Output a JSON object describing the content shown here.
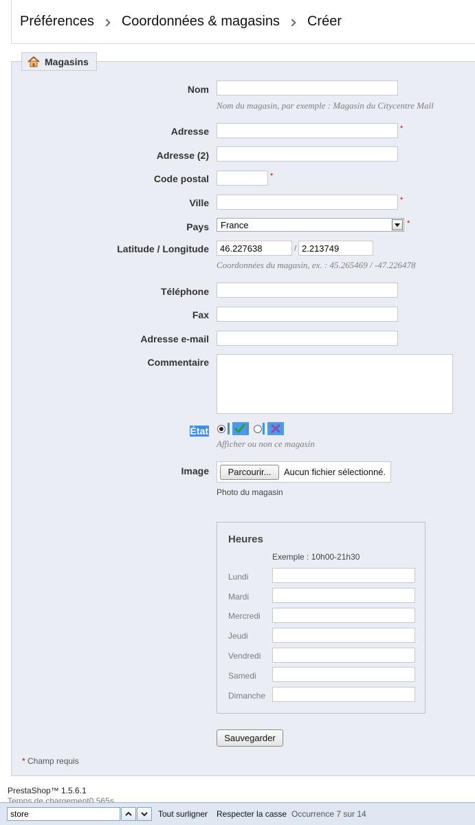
{
  "breadcrumb": [
    "Préférences",
    "Coordonnées & magasins",
    "Créer"
  ],
  "legend": "Magasins",
  "form": {
    "name_label": "Nom",
    "name_hint": "Nom du magasin, par exemple : Magasin du Citycentre Mall",
    "address_label": "Adresse",
    "address2_label": "Adresse (2)",
    "postcode_label": "Code postal",
    "city_label": "Ville",
    "country_label": "Pays",
    "country_value": "France",
    "latlng_label": "Latitude / Longitude",
    "latitude_value": "46.227638",
    "longitude_value": "2.213749",
    "latlng_separator": "/",
    "latlng_hint": "Coordonnées du magasin, ex. : 45.265469 / -47.226478",
    "phone_label": "Téléphone",
    "fax_label": "Fax",
    "email_label": "Adresse e-mail",
    "comment_label": "Commentaire",
    "state_label": "État",
    "state_hint": "Afficher ou non ce magasin",
    "image_label": "Image",
    "browse_button": "Parcourir...",
    "no_file": "Aucun fichier sélectionné.",
    "image_hint": "Photo du magasin",
    "required_marker": "*"
  },
  "hours": {
    "title": "Heures",
    "example": "Exemple : 10h00-21h30",
    "days": [
      "Lundi",
      "Mardi",
      "Mercredi",
      "Jeudi",
      "Vendredi",
      "Samedi",
      "Dimanche"
    ]
  },
  "save_button": "Sauvegarder",
  "required_note": "Champ requis",
  "footer": {
    "version": "PrestaShop™ 1.5.6.1",
    "load_time": "Temps de chargement0.565s"
  },
  "findbar": {
    "query": "store",
    "highlight_all": "Tout surligner",
    "match_case": "Respecter la casse",
    "status": "Occurrence 7 sur 14"
  },
  "colors": {
    "panel_bg": "#ebedf4",
    "required": "#cc0000",
    "selection": "#3d8fe8",
    "enabled_icon": "#2e9a3c",
    "disabled_icon": "#8a4fb0"
  }
}
